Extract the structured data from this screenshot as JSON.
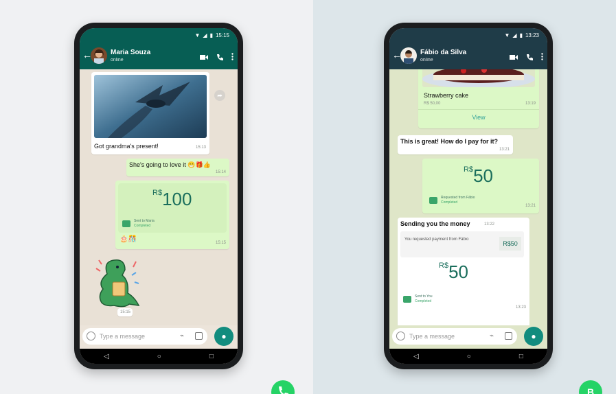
{
  "colors": {
    "accent": "#075e54",
    "bubble_out": "#dcf8c6",
    "mic": "#128c7e"
  },
  "left_phone": {
    "status_time": "15:15",
    "contact_name": "Maria Souza",
    "contact_status": "online",
    "messages": {
      "photo_caption": "Got grandma's present!",
      "photo_time": "15:13",
      "reply_text": "She's going to love it 😁🎁👍",
      "reply_time": "15:14",
      "payment_currency": "R$",
      "payment_amount": "100",
      "payment_line1": "Sent to Maria",
      "payment_line2": "Completed",
      "payment_reactions": "🎂🎊",
      "payment_time": "15:15",
      "sticker_time": "15:15"
    },
    "input_placeholder": "Type a message"
  },
  "right_phone": {
    "status_time": "13:23",
    "contact_name": "Fábio da Silva",
    "contact_status": "online",
    "messages": {
      "product_name": "Strawberry cake",
      "product_price": "R$ 50,00",
      "product_time": "13:19",
      "product_view": "View",
      "question_text": "This is great! How do I pay for it?",
      "question_time": "13:21",
      "request_currency": "R$",
      "request_amount": "50",
      "request_line1": "Requested from Fábio",
      "request_line2": "Completed",
      "request_time": "13:21",
      "sending_text": "Sending you the money",
      "sending_time": "13:22",
      "quoted_text": "You requested payment from Fábio",
      "quoted_amount": "R$50",
      "sent_currency": "R$",
      "sent_amount": "50",
      "sent_line1": "Sent to You",
      "sent_line2": "Completed",
      "sent_time": "13:23"
    },
    "input_placeholder": "Type a message"
  },
  "nav_icons": [
    "back-triangle-icon",
    "home-circle-icon",
    "recents-square-icon"
  ],
  "logo_right_letter": "B"
}
